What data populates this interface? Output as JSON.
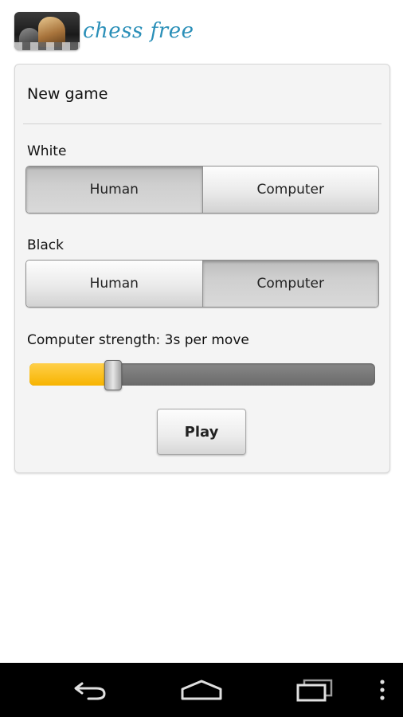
{
  "app": {
    "logo_text": "chess free"
  },
  "new_game": {
    "title": "New game",
    "white": {
      "label": "White",
      "options": [
        "Human",
        "Computer"
      ],
      "selected": "Human"
    },
    "black": {
      "label": "Black",
      "options": [
        "Human",
        "Computer"
      ],
      "selected": "Computer"
    },
    "strength": {
      "label": "Computer strength: 3s per move",
      "slider_fraction": 0.24
    },
    "play_label": "Play"
  },
  "navbar": {
    "icons": [
      "back-icon",
      "home-icon",
      "recent-apps-icon",
      "menu-icon"
    ]
  },
  "colors": {
    "slider_fill": "#f7b400",
    "logo_text": "#2a8fb8",
    "navbar": "#000000"
  }
}
